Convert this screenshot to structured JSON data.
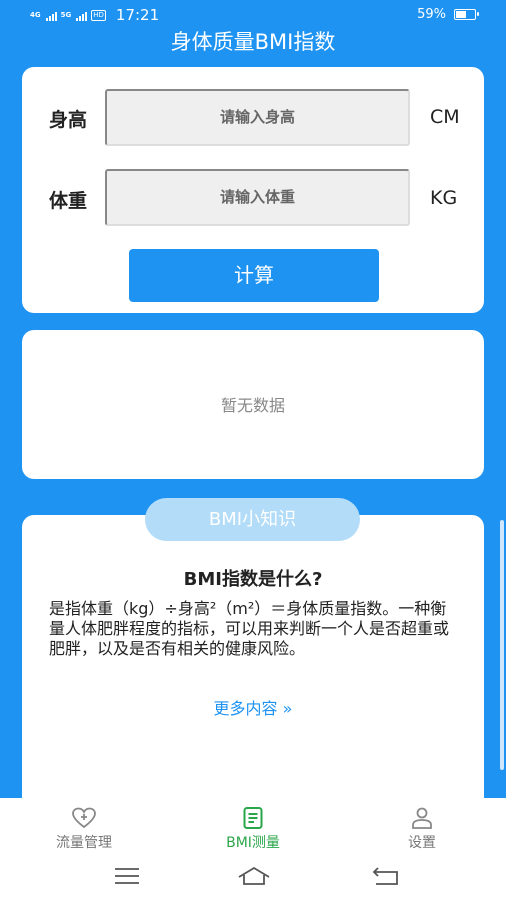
{
  "status_bar": {
    "network_1": "4G",
    "network_2": "5G",
    "hd_label": "HD",
    "time": "17:21",
    "battery_text": "59%",
    "battery_level": 0.59
  },
  "header": {
    "title": "身体质量BMI指数"
  },
  "input_card": {
    "height_label": "身高",
    "height_placeholder": "请输入身高",
    "height_unit": "CM",
    "weight_label": "体重",
    "weight_placeholder": "请输入体重",
    "weight_unit": "KG",
    "calculate_label": "计算"
  },
  "result_card": {
    "empty_text": "暂无数据"
  },
  "knowledge": {
    "badge": "BMI小知识",
    "title": "BMI指数是什么?",
    "body": "是指体重（kg）÷身高²（m²）＝身体质量指数。一种衡量人体肥胖程度的指标，可以用来判断一个人是否超重或肥胖，以及是否有相关的健康风险。",
    "more": "更多内容 »"
  },
  "tabs": [
    {
      "label": "流量管理",
      "icon": "heart-plus-icon",
      "active": false
    },
    {
      "label": "BMI测量",
      "icon": "document-icon",
      "active": true
    },
    {
      "label": "设置",
      "icon": "person-icon",
      "active": false
    }
  ],
  "colors": {
    "primary": "#1f93f2",
    "active_tab": "#2aa64a",
    "badge": "#b3dcf9"
  }
}
